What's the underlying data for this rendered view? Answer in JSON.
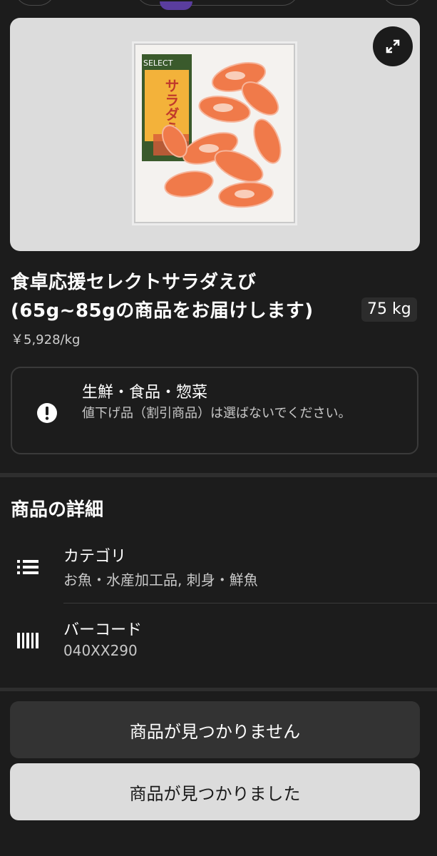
{
  "product": {
    "name": "食卓応援セレクトサラダえび(65g~85gの商品をお届けします)",
    "weight": "75 kg",
    "unit_price": "￥5,928/kg",
    "package_label": "サラダえび",
    "package_brand": "SELECT"
  },
  "notice": {
    "title": "生鮮・食品・惣菜",
    "body": "値下げ品（割引商品）は選ばないでください。",
    "icon": "alert-circle-icon"
  },
  "details": {
    "section_title": "商品の詳細",
    "category": {
      "label": "カテゴリ",
      "value": "お魚・水産加工品, 刺身・鮮魚",
      "icon": "list-icon"
    },
    "barcode": {
      "label": "バーコード",
      "value": "040XX290",
      "icon": "barcode-icon"
    }
  },
  "actions": {
    "not_found_label": "商品が見つかりません",
    "found_label": "商品が見つかりました"
  },
  "colors": {
    "background": "#1c1c1c",
    "accent": "#5a3d9e"
  }
}
